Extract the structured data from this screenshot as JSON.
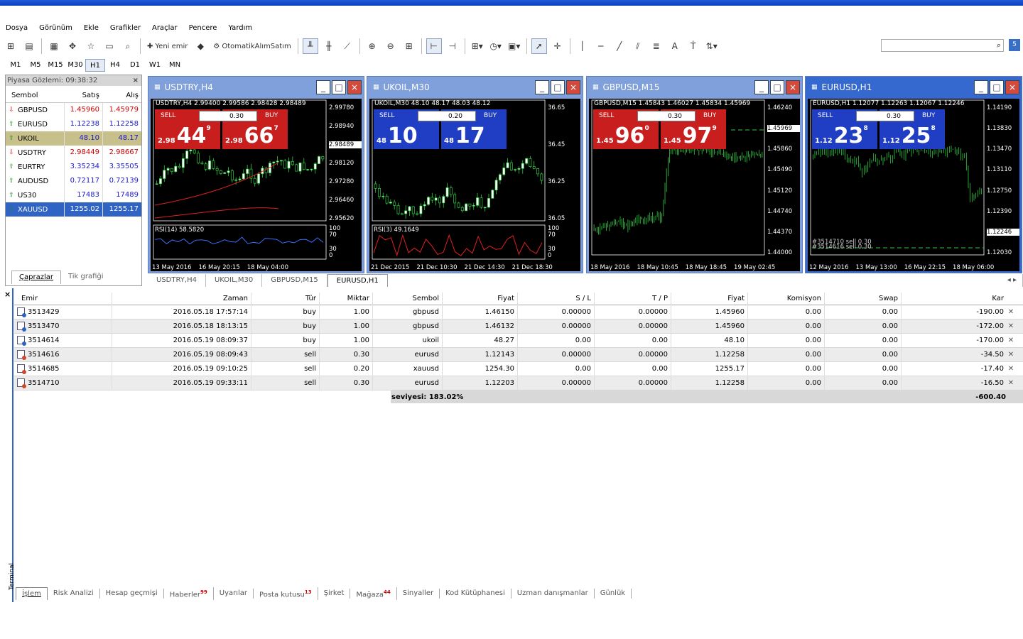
{
  "menu": [
    "Dosya",
    "Görünüm",
    "Ekle",
    "Grafikler",
    "Araçlar",
    "Pencere",
    "Yardım"
  ],
  "toolbar": {
    "new_order": "Yeni emir",
    "auto_trade": "OtomatikAlımSatım"
  },
  "timeframes": [
    "M1",
    "M5",
    "M15",
    "M30",
    "H1",
    "H4",
    "D1",
    "W1",
    "MN"
  ],
  "selected_timeframe": "H1",
  "msg_badge": "5",
  "market_watch": {
    "header": "Piyasa Gözlemi: 09:38:32",
    "col_symbol": "Sembol",
    "col_bid": "Satış",
    "col_ask": "Alış",
    "rows": [
      {
        "sym": "GBPUSD",
        "bid": "1.45960",
        "ask": "1.45979",
        "dir": "down"
      },
      {
        "sym": "EURUSD",
        "bid": "1.12238",
        "ask": "1.12258",
        "dir": "up"
      },
      {
        "sym": "UKOIL",
        "bid": "48.10",
        "ask": "48.17",
        "dir": "up"
      },
      {
        "sym": "USDTRY",
        "bid": "2.98449",
        "ask": "2.98667",
        "dir": "down"
      },
      {
        "sym": "EURTRY",
        "bid": "3.35234",
        "ask": "3.35505",
        "dir": "up"
      },
      {
        "sym": "AUDUSD",
        "bid": "0.72117",
        "ask": "0.72139",
        "dir": "up"
      },
      {
        "sym": "US30",
        "bid": "17483",
        "ask": "17489",
        "dir": "up"
      },
      {
        "sym": "XAUUSD",
        "bid": "1255.02",
        "ask": "1255.17",
        "dir": "up"
      }
    ],
    "tab_pairs": "Çaprazlar",
    "tab_tick": "Tik grafiği"
  },
  "charts": [
    {
      "title": "USDTRY,H4",
      "ohlc": "USDTRY,H4  2.99400 2.99586 2.98428 2.98489",
      "vol": "0.30",
      "sell_label": "SELL",
      "buy_label": "BUY",
      "sell_pre": "2.98",
      "sell_main": "44",
      "sell_sup": "9",
      "buy_pre": "2.98",
      "buy_main": "66",
      "buy_sup": "7",
      "axis": [
        "2.99780",
        "2.98940",
        "2.98489",
        "2.98120",
        "2.97280",
        "2.96460",
        "2.95620"
      ],
      "rsi": "RSI(14) 58.5820",
      "rsi_axis": [
        "100",
        "70",
        "30",
        "0"
      ],
      "dates": [
        "13 May 2016",
        "16 May 20:15",
        "18 May 04:00"
      ]
    },
    {
      "title": "UKOIL,M30",
      "ohlc": "UKOIL,M30  48.10 48.17 48.03 48.12",
      "vol": "0.20",
      "sell_label": "SELL",
      "buy_label": "BUY",
      "sell_pre": "48",
      "sell_main": "10",
      "sell_sup": "",
      "buy_pre": "48",
      "buy_main": "17",
      "buy_sup": "",
      "axis": [
        "36.65",
        "36.45",
        "36.25",
        "36.05"
      ],
      "rsi": "RSI(3) 49.1649",
      "rsi_axis": [
        "100",
        "70",
        "30",
        "0"
      ],
      "dates": [
        "21 Dec 2015",
        "21 Dec 10:30",
        "21 Dec 14:30",
        "21 Dec 18:30"
      ]
    },
    {
      "title": "GBPUSD,M15",
      "ohlc": "GBPUSD,M15  1.45843 1.46027 1.45834 1.45969",
      "vol": "0.30",
      "sell_label": "SELL",
      "buy_label": "BUY",
      "sell_pre": "1.45",
      "sell_main": "96",
      "sell_sup": "0",
      "buy_pre": "1.45",
      "buy_main": "97",
      "buy_sup": "9",
      "axis": [
        "1.46240",
        "1.45969",
        "1.45860",
        "1.45490",
        "1.45120",
        "1.44740",
        "1.44370",
        "1.44000"
      ],
      "dates": [
        "18 May 2016",
        "18 May 10:45",
        "18 May 18:45",
        "19 May 02:45"
      ]
    },
    {
      "title": "EURUSD,H1",
      "ohlc": "EURUSD,H1  1.12077 1.12263 1.12067 1.12246",
      "vol": "0.30",
      "sell_label": "SELL",
      "buy_label": "BUY",
      "sell_pre": "1.12",
      "sell_main": "23",
      "sell_sup": "8",
      "buy_pre": "1.12",
      "buy_main": "25",
      "buy_sup": "8",
      "axis": [
        "1.14190",
        "1.13830",
        "1.13470",
        "1.13110",
        "1.12750",
        "1.12390",
        "1.12246",
        "1.12030"
      ],
      "trade_lines": [
        "#3514710 sell 0.30",
        "#3514616 sell 0.30"
      ],
      "dates": [
        "12 May 2016",
        "13 May 13:00",
        "16 May 22:15",
        "18 May 06:00"
      ]
    }
  ],
  "chart_tabs": [
    "USDTRY,H4",
    "UKOIL,M30",
    "GBPUSD,M15",
    "EURUSD,H1"
  ],
  "selected_chart_tab": "EURUSD,H1",
  "terminal": {
    "side_label": "Terminal",
    "headers": [
      "Emir",
      "Zaman",
      "Tür",
      "Miktar",
      "Sembol",
      "Fiyat",
      "S / L",
      "T / P",
      "Fiyat",
      "Komisyon",
      "Swap",
      "Kar"
    ],
    "rows": [
      [
        "3513429",
        "2016.05.18 17:57:14",
        "buy",
        "1.00",
        "gbpusd",
        "1.46150",
        "0.00000",
        "0.00000",
        "1.45960",
        "0.00",
        "0.00",
        "-190.00"
      ],
      [
        "3513470",
        "2016.05.18 18:13:15",
        "buy",
        "1.00",
        "gbpusd",
        "1.46132",
        "0.00000",
        "0.00000",
        "1.45960",
        "0.00",
        "0.00",
        "-172.00"
      ],
      [
        "3514614",
        "2016.05.19 08:09:37",
        "buy",
        "1.00",
        "ukoil",
        "48.27",
        "0.00",
        "0.00",
        "48.10",
        "0.00",
        "0.00",
        "-170.00"
      ],
      [
        "3514616",
        "2016.05.19 08:09:43",
        "sell",
        "0.30",
        "eurusd",
        "1.12143",
        "0.00000",
        "0.00000",
        "1.12258",
        "0.00",
        "0.00",
        "-34.50"
      ],
      [
        "3514685",
        "2016.05.19 09:10:25",
        "sell",
        "0.20",
        "xauusd",
        "1254.30",
        "0.00",
        "0.00",
        "1255.17",
        "0.00",
        "0.00",
        "-17.40"
      ],
      [
        "3514710",
        "2016.05.19 09:33:11",
        "sell",
        "0.30",
        "eurusd",
        "1.12203",
        "0.00000",
        "0.00000",
        "1.12258",
        "0.00",
        "0.00",
        "-16.50"
      ]
    ],
    "summary_level": "seviyesi: 183.02%",
    "summary_total": "-600.40",
    "tabs": [
      {
        "label": "İşlem",
        "badge": ""
      },
      {
        "label": "Risk Analizi",
        "badge": ""
      },
      {
        "label": "Hesap geçmişi",
        "badge": ""
      },
      {
        "label": "Haberler",
        "badge": "99"
      },
      {
        "label": "Uyarılar",
        "badge": ""
      },
      {
        "label": "Posta kutusu",
        "badge": "13"
      },
      {
        "label": "Şirket",
        "badge": ""
      },
      {
        "label": "Mağaza",
        "badge": "44"
      },
      {
        "label": "Sinyaller",
        "badge": ""
      },
      {
        "label": "Kod Kütüphanesi",
        "badge": ""
      },
      {
        "label": "Uzman danışmanlar",
        "badge": ""
      },
      {
        "label": "Günlük",
        "badge": ""
      }
    ]
  }
}
